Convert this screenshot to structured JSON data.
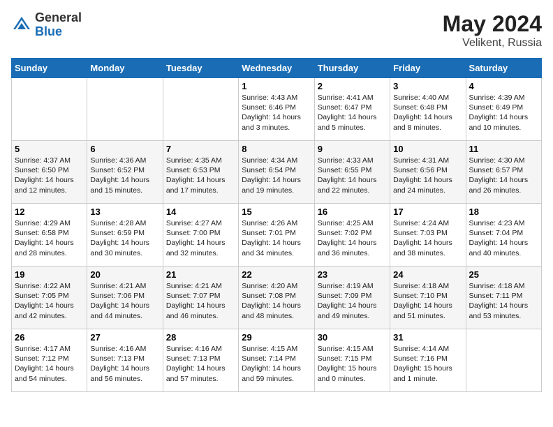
{
  "header": {
    "logo_general": "General",
    "logo_blue": "Blue",
    "title": "May 2024",
    "location": "Velikent, Russia"
  },
  "days_of_week": [
    "Sunday",
    "Monday",
    "Tuesday",
    "Wednesday",
    "Thursday",
    "Friday",
    "Saturday"
  ],
  "weeks": [
    [
      {
        "day": "",
        "info": ""
      },
      {
        "day": "",
        "info": ""
      },
      {
        "day": "",
        "info": ""
      },
      {
        "day": "1",
        "info": "Sunrise: 4:43 AM\nSunset: 6:46 PM\nDaylight: 14 hours and 3 minutes."
      },
      {
        "day": "2",
        "info": "Sunrise: 4:41 AM\nSunset: 6:47 PM\nDaylight: 14 hours and 5 minutes."
      },
      {
        "day": "3",
        "info": "Sunrise: 4:40 AM\nSunset: 6:48 PM\nDaylight: 14 hours and 8 minutes."
      },
      {
        "day": "4",
        "info": "Sunrise: 4:39 AM\nSunset: 6:49 PM\nDaylight: 14 hours and 10 minutes."
      }
    ],
    [
      {
        "day": "5",
        "info": "Sunrise: 4:37 AM\nSunset: 6:50 PM\nDaylight: 14 hours and 12 minutes."
      },
      {
        "day": "6",
        "info": "Sunrise: 4:36 AM\nSunset: 6:52 PM\nDaylight: 14 hours and 15 minutes."
      },
      {
        "day": "7",
        "info": "Sunrise: 4:35 AM\nSunset: 6:53 PM\nDaylight: 14 hours and 17 minutes."
      },
      {
        "day": "8",
        "info": "Sunrise: 4:34 AM\nSunset: 6:54 PM\nDaylight: 14 hours and 19 minutes."
      },
      {
        "day": "9",
        "info": "Sunrise: 4:33 AM\nSunset: 6:55 PM\nDaylight: 14 hours and 22 minutes."
      },
      {
        "day": "10",
        "info": "Sunrise: 4:31 AM\nSunset: 6:56 PM\nDaylight: 14 hours and 24 minutes."
      },
      {
        "day": "11",
        "info": "Sunrise: 4:30 AM\nSunset: 6:57 PM\nDaylight: 14 hours and 26 minutes."
      }
    ],
    [
      {
        "day": "12",
        "info": "Sunrise: 4:29 AM\nSunset: 6:58 PM\nDaylight: 14 hours and 28 minutes."
      },
      {
        "day": "13",
        "info": "Sunrise: 4:28 AM\nSunset: 6:59 PM\nDaylight: 14 hours and 30 minutes."
      },
      {
        "day": "14",
        "info": "Sunrise: 4:27 AM\nSunset: 7:00 PM\nDaylight: 14 hours and 32 minutes."
      },
      {
        "day": "15",
        "info": "Sunrise: 4:26 AM\nSunset: 7:01 PM\nDaylight: 14 hours and 34 minutes."
      },
      {
        "day": "16",
        "info": "Sunrise: 4:25 AM\nSunset: 7:02 PM\nDaylight: 14 hours and 36 minutes."
      },
      {
        "day": "17",
        "info": "Sunrise: 4:24 AM\nSunset: 7:03 PM\nDaylight: 14 hours and 38 minutes."
      },
      {
        "day": "18",
        "info": "Sunrise: 4:23 AM\nSunset: 7:04 PM\nDaylight: 14 hours and 40 minutes."
      }
    ],
    [
      {
        "day": "19",
        "info": "Sunrise: 4:22 AM\nSunset: 7:05 PM\nDaylight: 14 hours and 42 minutes."
      },
      {
        "day": "20",
        "info": "Sunrise: 4:21 AM\nSunset: 7:06 PM\nDaylight: 14 hours and 44 minutes."
      },
      {
        "day": "21",
        "info": "Sunrise: 4:21 AM\nSunset: 7:07 PM\nDaylight: 14 hours and 46 minutes."
      },
      {
        "day": "22",
        "info": "Sunrise: 4:20 AM\nSunset: 7:08 PM\nDaylight: 14 hours and 48 minutes."
      },
      {
        "day": "23",
        "info": "Sunrise: 4:19 AM\nSunset: 7:09 PM\nDaylight: 14 hours and 49 minutes."
      },
      {
        "day": "24",
        "info": "Sunrise: 4:18 AM\nSunset: 7:10 PM\nDaylight: 14 hours and 51 minutes."
      },
      {
        "day": "25",
        "info": "Sunrise: 4:18 AM\nSunset: 7:11 PM\nDaylight: 14 hours and 53 minutes."
      }
    ],
    [
      {
        "day": "26",
        "info": "Sunrise: 4:17 AM\nSunset: 7:12 PM\nDaylight: 14 hours and 54 minutes."
      },
      {
        "day": "27",
        "info": "Sunrise: 4:16 AM\nSunset: 7:13 PM\nDaylight: 14 hours and 56 minutes."
      },
      {
        "day": "28",
        "info": "Sunrise: 4:16 AM\nSunset: 7:13 PM\nDaylight: 14 hours and 57 minutes."
      },
      {
        "day": "29",
        "info": "Sunrise: 4:15 AM\nSunset: 7:14 PM\nDaylight: 14 hours and 59 minutes."
      },
      {
        "day": "30",
        "info": "Sunrise: 4:15 AM\nSunset: 7:15 PM\nDaylight: 15 hours and 0 minutes."
      },
      {
        "day": "31",
        "info": "Sunrise: 4:14 AM\nSunset: 7:16 PM\nDaylight: 15 hours and 1 minute."
      },
      {
        "day": "",
        "info": ""
      }
    ]
  ]
}
